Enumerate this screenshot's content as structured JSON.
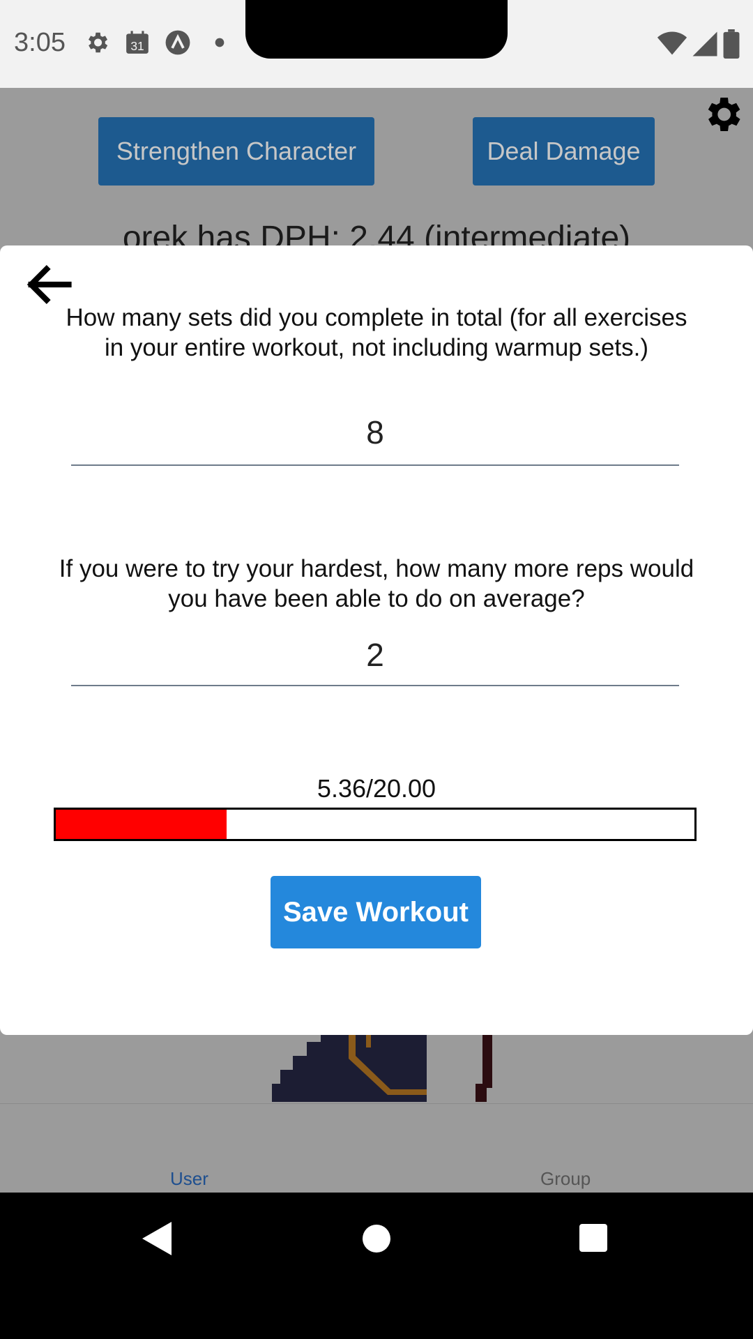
{
  "status_bar": {
    "time": "3:05",
    "calendar_day": "31"
  },
  "background_app": {
    "buttons": {
      "strengthen": "Strengthen Character",
      "deal_damage": "Deal Damage"
    },
    "heading": "orek has DPH: 2.44 (intermediate)",
    "tabs": [
      {
        "label": "User",
        "active": true
      },
      {
        "label": "Group",
        "active": false
      }
    ],
    "colors": {
      "button": "#1d5a8f",
      "active_tab": "#1e4f8f",
      "inactive_tab": "#555555"
    }
  },
  "modal": {
    "question_sets": "How many sets did you complete in total (for all exercises in your entire workout, not including warmup sets.)",
    "answer_sets": "8",
    "question_reps": "If you were to try your hardest, how many more reps would you have been able to do on average?",
    "answer_reps": "2",
    "progress": {
      "label": "5.36/20.00",
      "value": 5.36,
      "max": 20.0,
      "fill_color": "#ff0000"
    },
    "save_label": "Save Workout",
    "save_color": "#2488dc"
  }
}
